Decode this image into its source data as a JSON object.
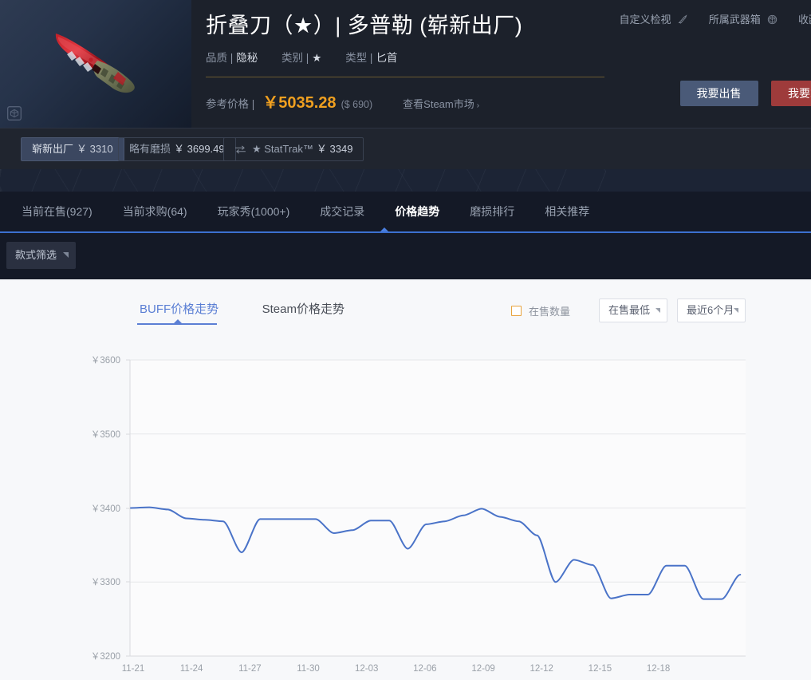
{
  "item": {
    "title": "折叠刀（★）| 多普勒 (崭新出厂)",
    "attrs": [
      {
        "key": "品质 |",
        "value": "隐秘"
      },
      {
        "key": "类别 |",
        "value": "★"
      },
      {
        "key": "类型 |",
        "value": "匕首"
      }
    ],
    "price_label": "参考价格 |",
    "price_cny": "￥5035.28",
    "price_usd": "($ 690)",
    "steam_link": "查看Steam市场",
    "steam_arrow": "›"
  },
  "header_links": [
    {
      "label": "自定义检视",
      "icon": "knife-icon"
    },
    {
      "label": "所属武器箱",
      "icon": "case-icon"
    },
    {
      "label": "收藏",
      "icon": "star-icon"
    }
  ],
  "header_buttons": {
    "sell": "我要出售",
    "buy": "我要求购"
  },
  "wear_tabs": [
    {
      "label": "崭新出厂",
      "price": "￥ 3310",
      "active": true,
      "icon": null
    },
    {
      "label": "略有磨损",
      "price": "￥ 3699.49",
      "active": false,
      "icon": null
    },
    {
      "label": "★ StatTrak™",
      "price": "￥ 3349",
      "active": false,
      "icon": "swap-icon"
    }
  ],
  "nav_tabs": [
    {
      "label": "当前在售(927)",
      "active": false
    },
    {
      "label": "当前求购(64)",
      "active": false
    },
    {
      "label": "玩家秀(1000+)",
      "active": false
    },
    {
      "label": "成交记录",
      "active": false
    },
    {
      "label": "价格趋势",
      "active": true
    },
    {
      "label": "磨损排行",
      "active": false
    },
    {
      "label": "相关推荐",
      "active": false
    }
  ],
  "filter": {
    "style_select": "款式筛选"
  },
  "chart_tabs": [
    {
      "label": "BUFF价格走势",
      "active": true
    },
    {
      "label": "Steam价格走势",
      "active": false
    }
  ],
  "chart_controls": {
    "checkbox_label": "在售数量",
    "checkbox_checked": false,
    "price_type": "在售最低",
    "range": "最近6个月"
  },
  "colors": {
    "accent_blue": "#4a7fe0",
    "line_blue": "#4a73c8",
    "price_orange": "#f0a020",
    "sell_button": "#4a5a78",
    "buy_button": "#9e3b3b",
    "checkbox_border": "#e8a33d",
    "header_bg": "#1c212b",
    "nav_bg": "#141926",
    "panel_bg": "#f7f8fa"
  },
  "chart_data": {
    "type": "line",
    "title": "BUFF价格走势",
    "xlabel": "",
    "ylabel": "",
    "ylim": [
      3200,
      3600
    ],
    "yticks": [
      3200,
      3300,
      3400,
      3500,
      3600
    ],
    "ytick_labels": [
      "￥3200",
      "￥3300",
      "￥3400",
      "￥3500",
      "￥3600"
    ],
    "xticks": [
      "11-21",
      "11-24",
      "11-27",
      "11-30",
      "12-03",
      "12-06",
      "12-09",
      "12-12",
      "12-15",
      "12-18"
    ],
    "grid": true,
    "legend": false,
    "series": [
      {
        "name": "在售最低",
        "color": "#4a73c8",
        "x": [
          "11-21",
          "11-22",
          "11-23",
          "11-24",
          "11-25",
          "11-26",
          "11-26.5",
          "11-27",
          "11-28",
          "11-29",
          "11-30",
          "12-01",
          "12-02",
          "12-03",
          "12-03.5",
          "12-04",
          "12-05",
          "12-06",
          "12-07",
          "12-08",
          "12-09",
          "12-10",
          "12-11",
          "12-11.5",
          "12-12",
          "12-12.5",
          "12-13",
          "12-14",
          "12-15",
          "12-16",
          "12-17",
          "12-18",
          "12-19",
          "12-20"
        ],
        "values": [
          3400,
          3401,
          3398,
          3386,
          3384,
          3382,
          3340,
          3385,
          3385,
          3385,
          3385,
          3366,
          3370,
          3383,
          3383,
          3345,
          3378,
          3382,
          3390,
          3399,
          3388,
          3382,
          3363,
          3300,
          3330,
          3323,
          3278,
          3283,
          3283,
          3322,
          3322,
          3277,
          3277,
          3310
        ]
      }
    ]
  }
}
